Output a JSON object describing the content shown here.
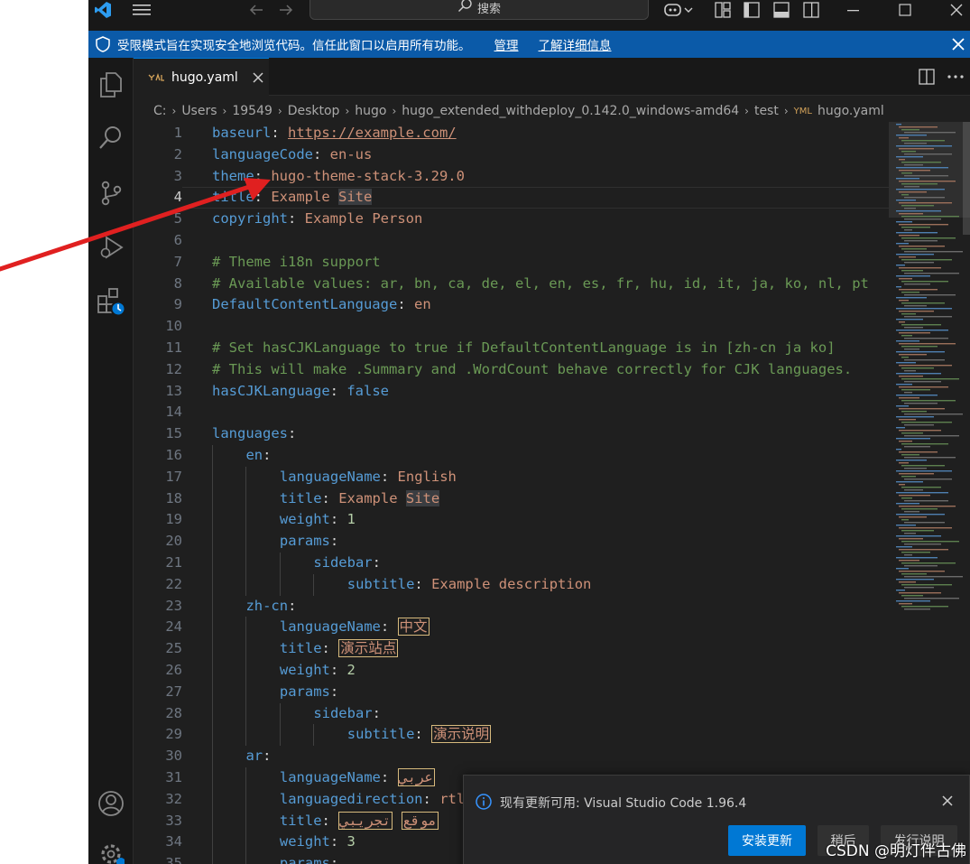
{
  "titlebar": {
    "search_label": "搜索"
  },
  "banner": {
    "message": "受限模式旨在实现安全地浏览代码。信任此窗口以启用所有功能。",
    "manage_link": "管理",
    "learn_more_link": "了解详细信息"
  },
  "tab": {
    "filename": "hugo.yaml"
  },
  "breadcrumb": [
    "C:",
    "Users",
    "19549",
    "Desktop",
    "hugo",
    "hugo_extended_withdeploy_0.142.0_windows-amd64",
    "test",
    "hugo.yaml"
  ],
  "editor": {
    "current_line": 4,
    "lines": [
      {
        "n": "1",
        "indent": 0,
        "tokens": [
          [
            "k",
            "baseurl"
          ],
          [
            "p",
            ": "
          ],
          [
            "u",
            "https://example.com/"
          ]
        ]
      },
      {
        "n": "2",
        "indent": 0,
        "tokens": [
          [
            "k",
            "languageCode"
          ],
          [
            "p",
            ": "
          ],
          [
            "s",
            "en-us"
          ]
        ]
      },
      {
        "n": "3",
        "indent": 0,
        "tokens": [
          [
            "k",
            "theme"
          ],
          [
            "p",
            ": "
          ],
          [
            "s",
            "hugo-theme-stack-3.29.0"
          ]
        ]
      },
      {
        "n": "4",
        "indent": 0,
        "tokens": [
          [
            "k",
            "title"
          ],
          [
            "p",
            ": "
          ],
          [
            "s",
            "Example "
          ],
          [
            "s hl",
            "Site"
          ]
        ]
      },
      {
        "n": "5",
        "indent": 0,
        "tokens": [
          [
            "k",
            "copyright"
          ],
          [
            "p",
            ": "
          ],
          [
            "s",
            "Example Person"
          ]
        ]
      },
      {
        "n": "6",
        "indent": 0,
        "tokens": []
      },
      {
        "n": "7",
        "indent": 0,
        "tokens": [
          [
            "c",
            "# Theme i18n support"
          ]
        ]
      },
      {
        "n": "8",
        "indent": 0,
        "tokens": [
          [
            "c",
            "# Available values: ar, bn, ca, de, el, en, es, fr, hu, id, it, ja, ko, nl, pt"
          ]
        ]
      },
      {
        "n": "9",
        "indent": 0,
        "tokens": [
          [
            "k",
            "DefaultContentLanguage"
          ],
          [
            "p",
            ": "
          ],
          [
            "s",
            "en"
          ]
        ]
      },
      {
        "n": "10",
        "indent": 0,
        "tokens": []
      },
      {
        "n": "11",
        "indent": 0,
        "tokens": [
          [
            "c",
            "# Set hasCJKLanguage to true if DefaultContentLanguage is in [zh-cn ja ko]"
          ]
        ]
      },
      {
        "n": "12",
        "indent": 0,
        "tokens": [
          [
            "c",
            "# This will make .Summary and .WordCount behave correctly for CJK languages."
          ]
        ]
      },
      {
        "n": "13",
        "indent": 0,
        "tokens": [
          [
            "k",
            "hasCJKLanguage"
          ],
          [
            "p",
            ": "
          ],
          [
            "k",
            "false"
          ]
        ]
      },
      {
        "n": "14",
        "indent": 0,
        "tokens": []
      },
      {
        "n": "15",
        "indent": 0,
        "tokens": [
          [
            "k",
            "languages"
          ],
          [
            "p",
            ":"
          ]
        ]
      },
      {
        "n": "16",
        "indent": 1,
        "tokens": [
          [
            "k",
            "en"
          ],
          [
            "p",
            ":"
          ]
        ]
      },
      {
        "n": "17",
        "indent": 2,
        "tokens": [
          [
            "k",
            "languageName"
          ],
          [
            "p",
            ": "
          ],
          [
            "s",
            "English"
          ]
        ]
      },
      {
        "n": "18",
        "indent": 2,
        "tokens": [
          [
            "k",
            "title"
          ],
          [
            "p",
            ": "
          ],
          [
            "s",
            "Example "
          ],
          [
            "s hl",
            "Site"
          ]
        ]
      },
      {
        "n": "19",
        "indent": 2,
        "tokens": [
          [
            "k",
            "weight"
          ],
          [
            "p",
            ": "
          ],
          [
            "n",
            "1"
          ]
        ]
      },
      {
        "n": "20",
        "indent": 2,
        "tokens": [
          [
            "k",
            "params"
          ],
          [
            "p",
            ":"
          ]
        ]
      },
      {
        "n": "21",
        "indent": 3,
        "tokens": [
          [
            "k",
            "sidebar"
          ],
          [
            "p",
            ":"
          ]
        ]
      },
      {
        "n": "22",
        "indent": 4,
        "tokens": [
          [
            "k",
            "subtitle"
          ],
          [
            "p",
            ": "
          ],
          [
            "s",
            "Example description"
          ]
        ]
      },
      {
        "n": "23",
        "indent": 1,
        "tokens": [
          [
            "k",
            "zh-cn"
          ],
          [
            "p",
            ":"
          ]
        ]
      },
      {
        "n": "24",
        "indent": 2,
        "tokens": [
          [
            "k",
            "languageName"
          ],
          [
            "p",
            ": "
          ],
          [
            "s uni",
            "中文"
          ]
        ]
      },
      {
        "n": "25",
        "indent": 2,
        "tokens": [
          [
            "k",
            "title"
          ],
          [
            "p",
            ": "
          ],
          [
            "s uni",
            "演示站点"
          ]
        ]
      },
      {
        "n": "26",
        "indent": 2,
        "tokens": [
          [
            "k",
            "weight"
          ],
          [
            "p",
            ": "
          ],
          [
            "n",
            "2"
          ]
        ]
      },
      {
        "n": "27",
        "indent": 2,
        "tokens": [
          [
            "k",
            "params"
          ],
          [
            "p",
            ":"
          ]
        ]
      },
      {
        "n": "28",
        "indent": 3,
        "tokens": [
          [
            "k",
            "sidebar"
          ],
          [
            "p",
            ":"
          ]
        ]
      },
      {
        "n": "29",
        "indent": 4,
        "tokens": [
          [
            "k",
            "subtitle"
          ],
          [
            "p",
            ": "
          ],
          [
            "s uni",
            "演示说明"
          ]
        ]
      },
      {
        "n": "30",
        "indent": 1,
        "tokens": [
          [
            "k",
            "ar"
          ],
          [
            "p",
            ":"
          ]
        ]
      },
      {
        "n": "31",
        "indent": 2,
        "tokens": [
          [
            "k",
            "languageName"
          ],
          [
            "p",
            ": "
          ],
          [
            "s uni",
            "عربي"
          ]
        ]
      },
      {
        "n": "32",
        "indent": 2,
        "tokens": [
          [
            "k",
            "languagedirection"
          ],
          [
            "p",
            ": "
          ],
          [
            "s",
            "rtl"
          ]
        ]
      },
      {
        "n": "33",
        "indent": 2,
        "tokens": [
          [
            "k",
            "title"
          ],
          [
            "p",
            ": "
          ],
          [
            "s uni",
            "موقع"
          ],
          [
            "p",
            " "
          ],
          [
            "s uni",
            "تجريبي"
          ]
        ]
      },
      {
        "n": "34",
        "indent": 2,
        "tokens": [
          [
            "k",
            "weight"
          ],
          [
            "p",
            ": "
          ],
          [
            "n",
            "3"
          ]
        ]
      },
      {
        "n": "35",
        "indent": 2,
        "tokens": [
          [
            "k",
            "params"
          ],
          [
            "p",
            ":"
          ]
        ]
      }
    ]
  },
  "notification": {
    "message": "现有更新可用: Visual Studio Code 1.96.4",
    "install_button": "安装更新",
    "later_button": "稍后",
    "release_notes_button": "发行说明"
  },
  "watermark": "CSDN @明灯伴古佛",
  "colors": {
    "accent": "#0078d4",
    "banner": "#0b5aa8",
    "arrow": "#e02020"
  }
}
